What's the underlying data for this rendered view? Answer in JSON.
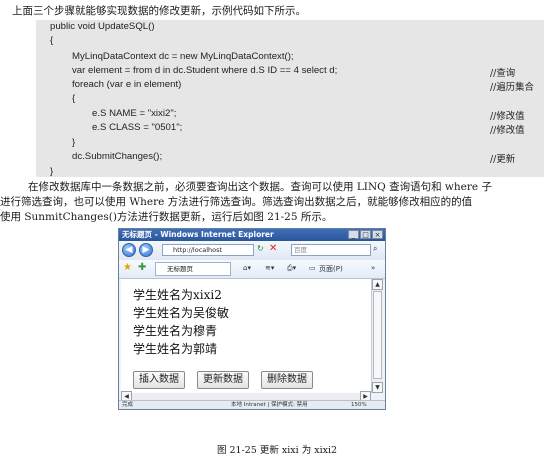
{
  "intro": "上面三个步骤就能够实现数据的修改更新，示例代码如下所示。",
  "code": {
    "lines": [
      "public void UpdateSQL()",
      "{",
      "MyLinqDataContext dc = new MyLinqDataContext();",
      "var element = from d in dc.Student where d.S  ID == 4 select d;",
      "foreach (var e in element)",
      "{",
      "e.S  NAME = \"xixi2\";",
      "e.S  CLASS = \"0501\";",
      "}",
      "dc.SubmitChanges();",
      "}"
    ],
    "comments": [
      "//查询",
      "//遍历集合",
      "//修改值",
      "//修改值",
      "//更新"
    ]
  },
  "paragraph": [
    "在修改数据库中一条数据之前，必须要查询出这个数据。查询可以使用 LINQ 查询语句和 where 子",
    "进行筛选查询，也可以使用 Where 方法进行筛选查询。筛选查询出数据之后，就能够修改相应的的值",
    "使用 SunmitChanges()方法进行数据更新，运行后如图 21-25 所示。"
  ],
  "browser": {
    "title": "无标题页 - Windows Internet Explorer",
    "address": "http://localhost",
    "search_placeholder": "百度",
    "tab_label": "无标题页",
    "page_menu": "页面(P)",
    "status_left": "完成",
    "status_zone": "本地 Intranet | 保护模式: 禁用",
    "status_zoom": "150%",
    "names": [
      "学生姓名为xixi2",
      "学生姓名为吴俊敏",
      "学生姓名为穆青",
      "学生姓名为郭靖"
    ],
    "buttons": [
      "插入数据",
      "更新数据",
      "删除数据"
    ]
  },
  "caption": "图 21-25   更新 xixi 为 xixi2"
}
